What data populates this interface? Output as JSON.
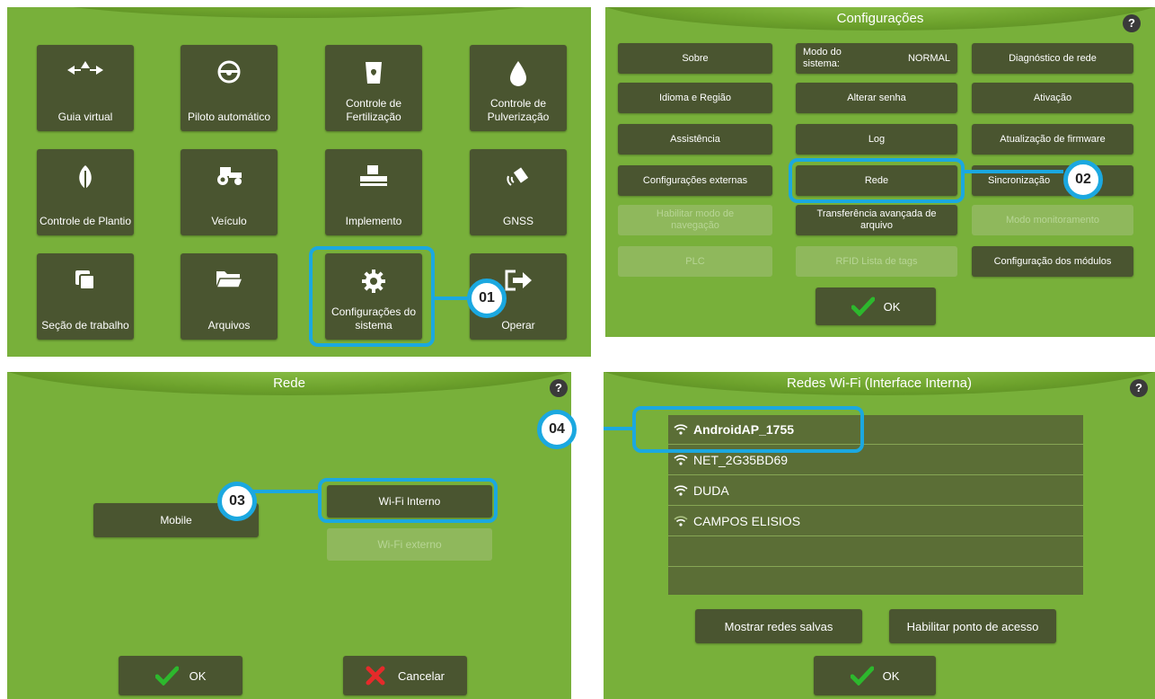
{
  "colors": {
    "accent": "#1ba8e0",
    "panel_bg": "#78b03a",
    "button": "#4a5530",
    "check": "#2db82d",
    "cancel": "#e52a2a"
  },
  "main_menu": {
    "tiles": [
      {
        "label": "Guia virtual",
        "icon": "arrows-icon"
      },
      {
        "label": "Piloto automático",
        "icon": "steering-wheel-icon"
      },
      {
        "label": "Controle de Fertilização",
        "icon": "fertilizer-bag-icon"
      },
      {
        "label": "Controle de Pulverização",
        "icon": "drop-icon"
      },
      {
        "label": "Controle de Plantio",
        "icon": "leaf-icon"
      },
      {
        "label": "Veículo",
        "icon": "tractor-icon"
      },
      {
        "label": "Implemento",
        "icon": "implement-icon"
      },
      {
        "label": "GNSS",
        "icon": "satellite-icon"
      },
      {
        "label": "Seção de trabalho",
        "icon": "section-icon"
      },
      {
        "label": "Arquivos",
        "icon": "folder-icon"
      },
      {
        "label": "Configurações do sistema",
        "icon": "gear-icon"
      },
      {
        "label": "Operar",
        "icon": "exit-icon"
      }
    ]
  },
  "config": {
    "title": "Configurações",
    "help": "?",
    "buttons": {
      "sobre": "Sobre",
      "modo_label": "Modo do sistema:",
      "modo_value": "NORMAL",
      "diagnostico": "Diagnóstico de rede",
      "idioma": "Idioma e Região",
      "senha": "Alterar senha",
      "ativacao": "Ativação",
      "assistencia": "Assistência",
      "log": "Log",
      "firmware": "Atualização de firmware",
      "externas": "Configurações externas",
      "rede": "Rede",
      "sincronizacao": "Sincronização",
      "navegacao": "Habilitar modo de navegação",
      "transferencia": "Transferência avançada de arquivo",
      "monitoramento": "Modo monitoramento",
      "plc": "PLC",
      "rfid": "RFID Lista de tags",
      "modulos": "Configuração dos módulos",
      "ok": "OK"
    }
  },
  "rede": {
    "title": "Rede",
    "help": "?",
    "mobile": "Mobile",
    "wifi_interno": "Wi-Fi Interno",
    "wifi_externo": "Wi-Fi externo",
    "ok": "OK",
    "cancelar": "Cancelar"
  },
  "wifi": {
    "title": "Redes Wi-Fi (Interface Interna)",
    "help": "?",
    "networks": [
      "AndroidAP_1755",
      "NET_2G35BD69",
      "DUDA",
      "CAMPOS ELISIOS"
    ],
    "mostrar": "Mostrar redes salvas",
    "habilitar": "Habilitar ponto de acesso",
    "ok": "OK"
  },
  "callouts": [
    "01",
    "02",
    "03",
    "04"
  ]
}
